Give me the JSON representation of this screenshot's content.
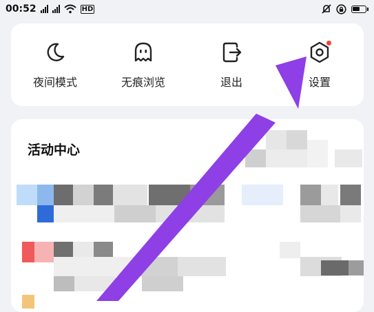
{
  "status_bar": {
    "time": "00:52",
    "signal_1": "4G",
    "signal_2": "4G",
    "wifi": "wifi-icon",
    "network_badge": "HD",
    "alarm": "bell-off-icon",
    "sync": "lock-icon",
    "battery": "battery-icon"
  },
  "tools": [
    {
      "label": "夜间模式",
      "icon": "moon-icon"
    },
    {
      "label": "无痕浏览",
      "icon": "ghost-icon"
    },
    {
      "label": "退出",
      "icon": "exit-icon"
    },
    {
      "label": "设置",
      "icon": "gear-icon",
      "badge": true
    }
  ],
  "activity": {
    "title": "活动中心"
  },
  "colors": {
    "arrow": "#8e3fe6",
    "badge": "#f44336",
    "background": "#f1f2f5"
  }
}
